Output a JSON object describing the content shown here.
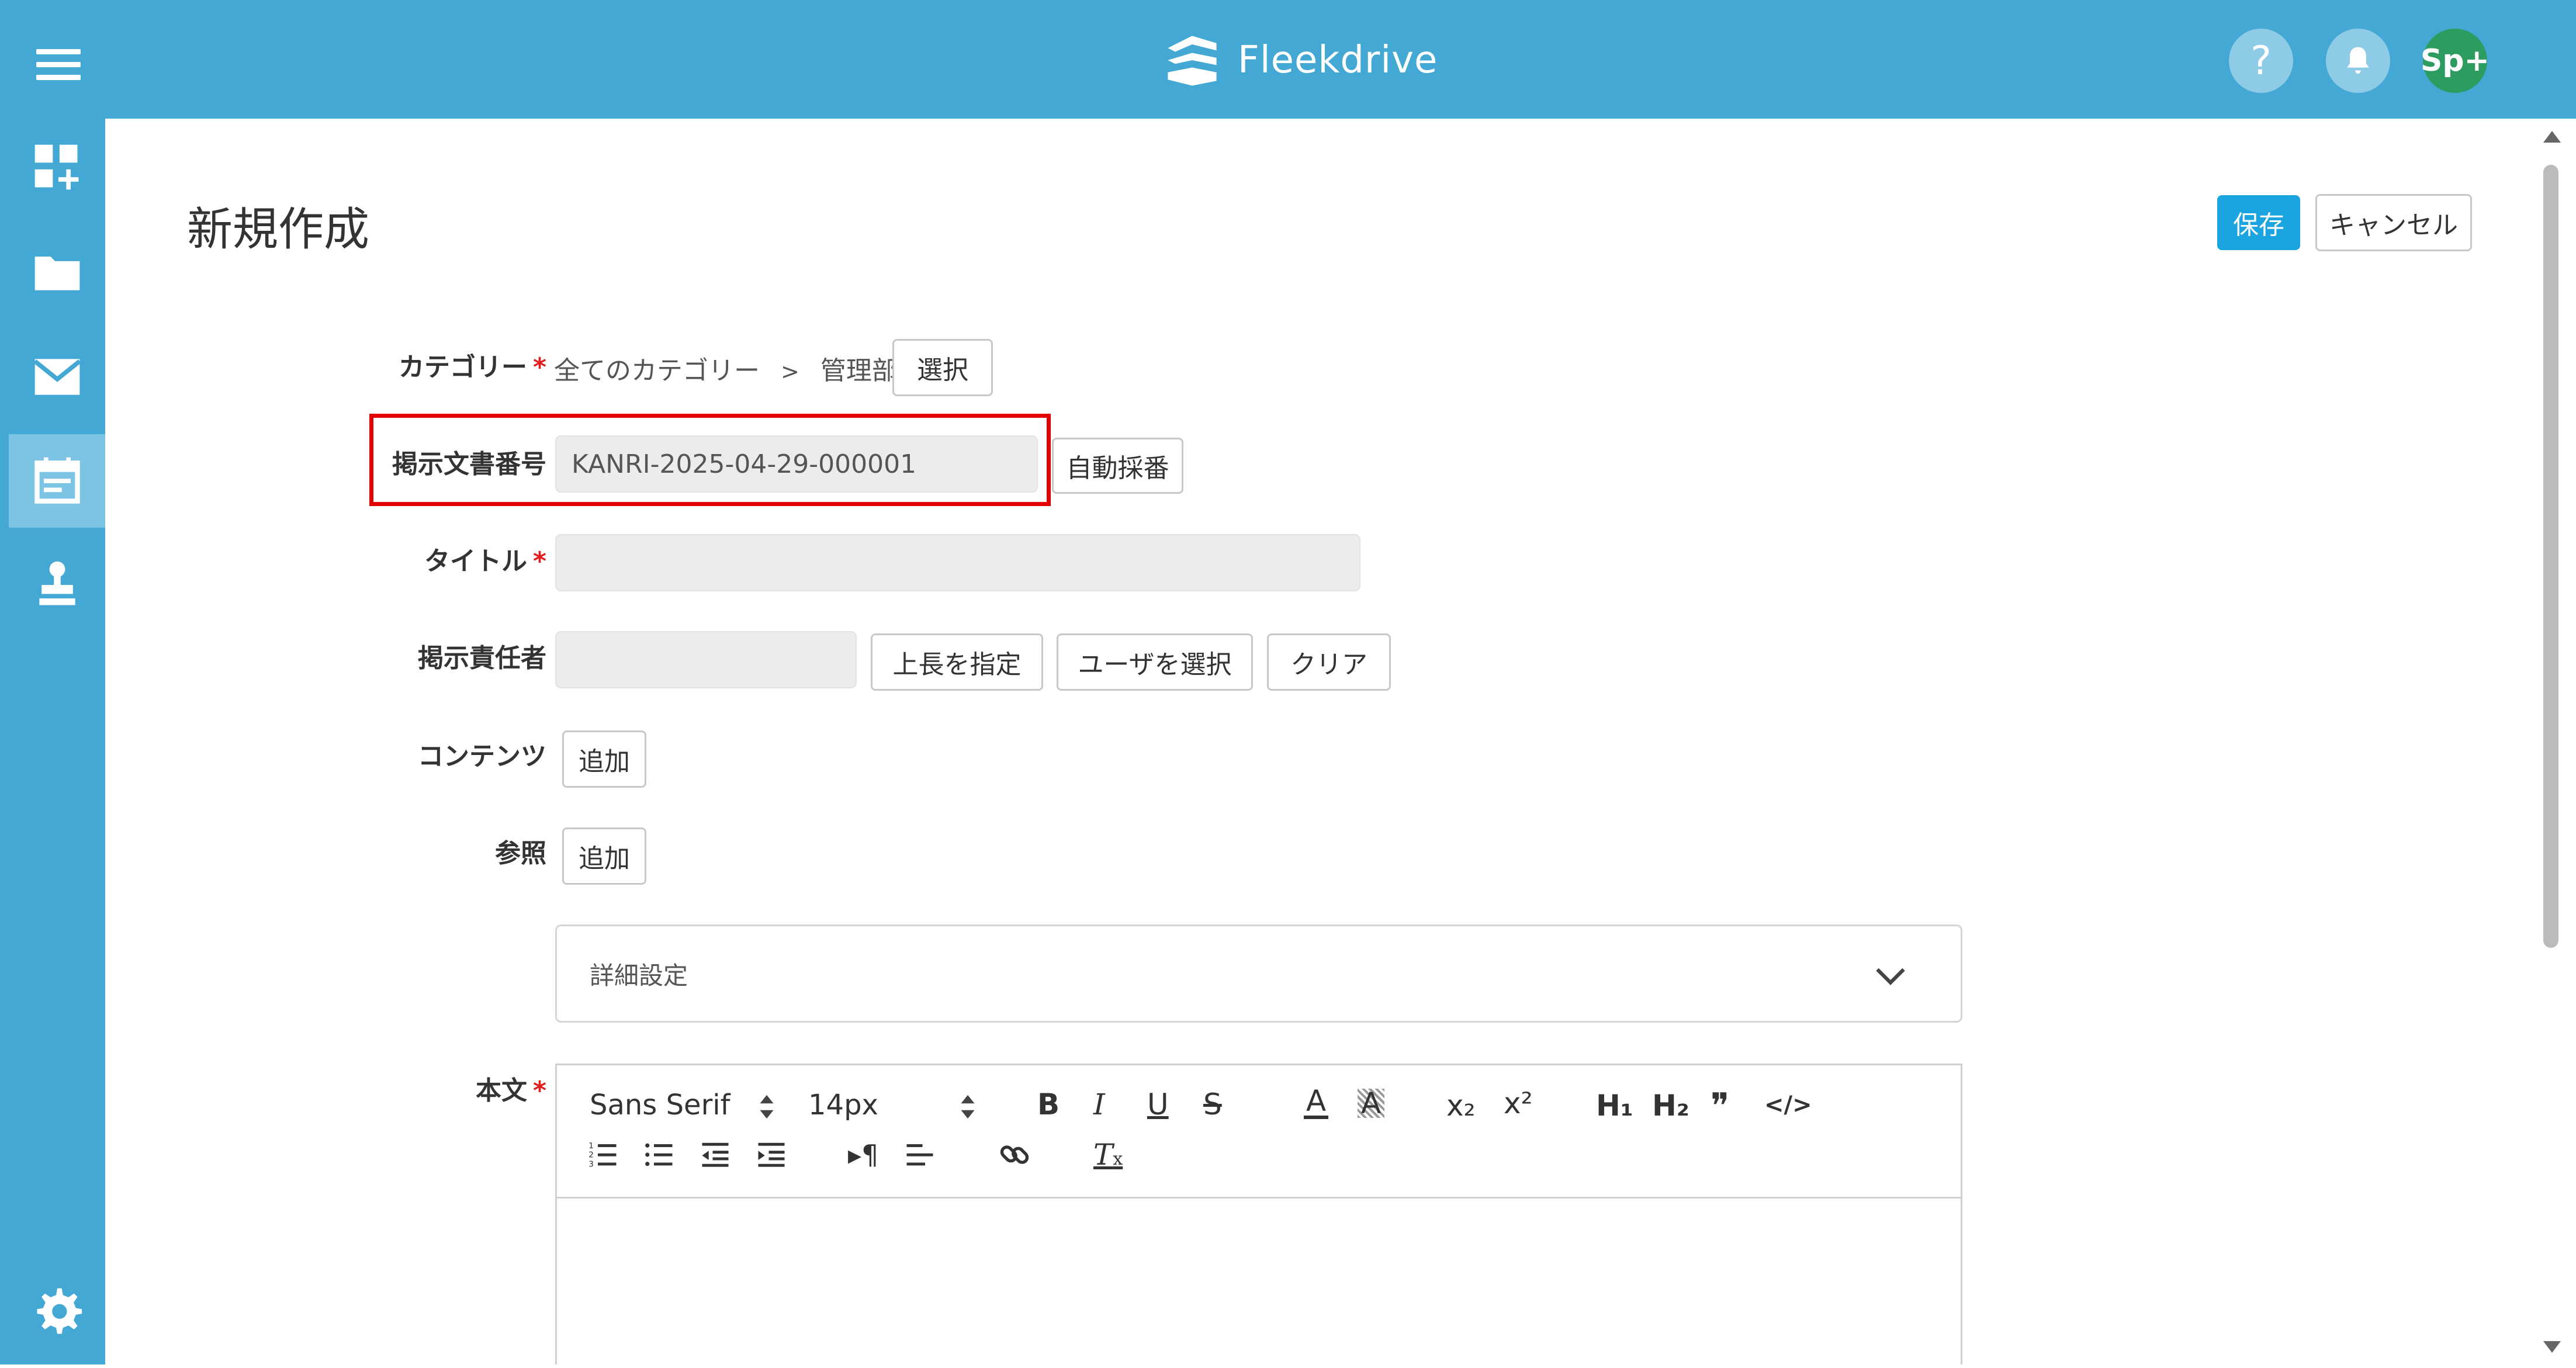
{
  "app": {
    "brand_name": "Fleekdrive",
    "avatar_text": "Sp+",
    "help_symbol": "?"
  },
  "page": {
    "title": "新規作成",
    "save_label": "保存",
    "cancel_label": "キャンセル"
  },
  "form": {
    "category": {
      "label": "カテゴリー",
      "required_mark": "*",
      "path_root": "全てのカテゴリー",
      "separator": ">",
      "path_leaf": "管理部",
      "select_button": "選択"
    },
    "doc_number": {
      "label": "掲示文書番号",
      "value": "KANRI-2025-04-29-000001",
      "auto_button": "自動採番"
    },
    "title": {
      "label": "タイトル",
      "required_mark": "*",
      "value": ""
    },
    "owner": {
      "label": "掲示責任者",
      "value": "",
      "boss_button": "上長を指定",
      "user_button": "ユーザを選択",
      "clear_button": "クリア"
    },
    "contents": {
      "label": "コンテンツ",
      "add_button": "追加"
    },
    "reference": {
      "label": "参照",
      "add_button": "追加"
    },
    "details": {
      "label": "詳細設定"
    },
    "body": {
      "label": "本文",
      "required_mark": "*"
    }
  },
  "editor": {
    "font_family": "Sans Serif",
    "font_size": "14px",
    "sub_label": "x₂",
    "sup_label": "x²",
    "h1_label": "H₁",
    "h2_label": "H₂",
    "quote_label": "❞",
    "code_label": "</>"
  },
  "colors": {
    "primary": "#44a8d4",
    "accent_button": "#1ba5e0",
    "highlight": "#e30000",
    "required": "#e11d1d",
    "avatar": "#2c9c61"
  }
}
